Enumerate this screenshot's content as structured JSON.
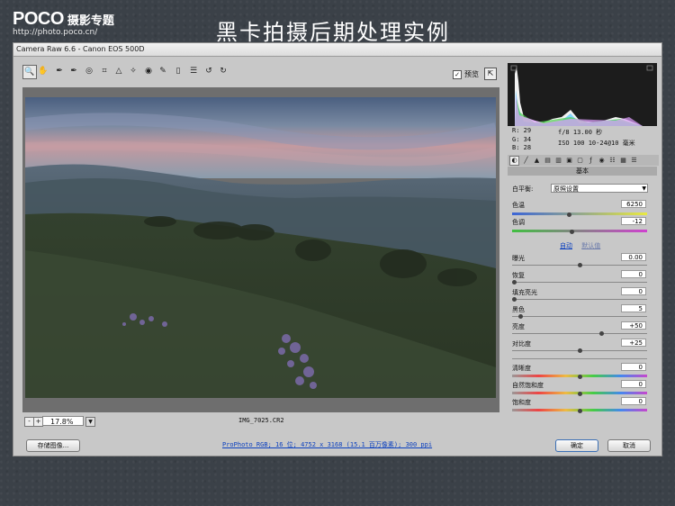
{
  "slide": {
    "logo_brand": "POCO",
    "logo_sub": "摄影专题",
    "logo_url": "http://photo.poco.cn/",
    "title": "黑卡拍摄后期处理实例"
  },
  "window": {
    "title": "Camera Raw 6.6  -  Canon EOS 500D",
    "preview_label": "预览",
    "preview_checked": "✓"
  },
  "toolbar": {
    "tools": [
      "zoom-tool",
      "hand-tool",
      "white-balance-tool",
      "color-sampler-tool",
      "target-adjust-tool",
      "crop-tool",
      "straighten-tool",
      "spot-removal-tool",
      "red-eye-tool",
      "adjustment-brush-tool",
      "graduated-filter-tool",
      "preferences-tool",
      "rotate-ccw-tool",
      "rotate-cw-tool"
    ]
  },
  "statusbar": {
    "zoom_minus": "-",
    "zoom_plus": "+",
    "zoom": "17.8%",
    "filename": "IMG_7025.CR2"
  },
  "info": {
    "r": "R:  29",
    "g": "G:  34",
    "b": "B:  28",
    "aperture_shutter": "f/8   13.00 秒",
    "iso_lens": "ISO 100   10-24@10 毫米"
  },
  "panel": {
    "header": "基本",
    "wb_label": "白平衡:",
    "wb_value": "原照设置",
    "temp_label": "色温",
    "temp_value": "6250",
    "tint_label": "色调",
    "tint_value": "-12",
    "auto_link": "自动",
    "default_link": "默认值",
    "adjustments": [
      {
        "label": "曝光",
        "value": "0.00",
        "level": 0.5
      },
      {
        "label": "恢复",
        "value": "0",
        "level": 0.0
      },
      {
        "label": "填充亮光",
        "value": "0",
        "level": 0.0
      },
      {
        "label": "黑色",
        "value": "5",
        "level": 0.05
      },
      {
        "label": "亮度",
        "value": "+50",
        "level": 0.67
      },
      {
        "label": "对比度",
        "value": "+25",
        "level": 0.5
      }
    ],
    "presence": [
      {
        "label": "清晰度",
        "value": "0",
        "level": 0.5
      },
      {
        "label": "自然饱和度",
        "value": "0",
        "level": 0.5
      },
      {
        "label": "饱和度",
        "value": "0",
        "level": 0.5
      }
    ],
    "temp_level": 0.42,
    "tint_level": 0.44
  },
  "footer": {
    "save_label": "存储图像...",
    "workflow": "ProPhoto RGB; 16 位; 4752 x 3168 (15.1 百万像素); 300 ppi",
    "open_label": "确定",
    "cancel_label": "取消"
  }
}
